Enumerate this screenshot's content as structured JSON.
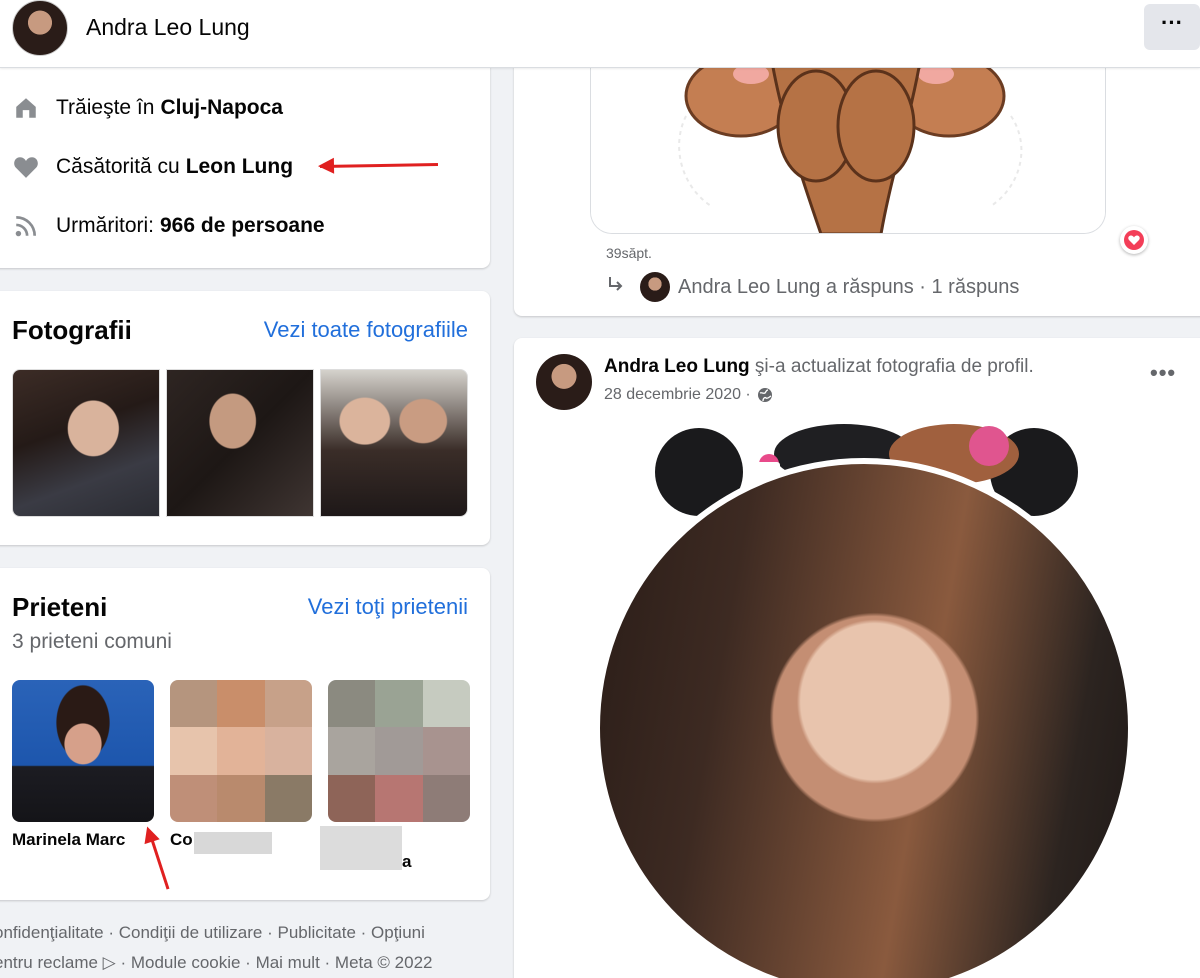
{
  "header": {
    "name": "Andra Leo Lung",
    "more_label": "···"
  },
  "intro": {
    "lives_prefix": "Trăieşte în",
    "lives_city": "Cluj-Napoca",
    "married_prefix": "Căsătorită cu",
    "married_to": "Leon Lung",
    "followers_prefix": "Urmăritori:",
    "followers_count": "966 de persoane"
  },
  "photos": {
    "title": "Fotografii",
    "link": "Vezi toate fotografiile"
  },
  "friends": {
    "title": "Prieteni",
    "link": "Vezi toţi prietenii",
    "mutual": "3 prieteni comuni",
    "items": [
      {
        "name": "Marinela Marc"
      },
      {
        "name": "Co"
      },
      {
        "name": "a"
      }
    ]
  },
  "footer": {
    "line1": "onfidenţialitate · Condiţii de utilizare · Publicitate · Opţiuni",
    "line2": "entru reclame ▷ · Module cookie · Mai mult · Meta © 2022"
  },
  "post1": {
    "time": "39săpt.",
    "reply_text": "Andra Leo Lung a răspuns · 1 răspuns"
  },
  "post2": {
    "author": "Andra Leo Lung",
    "action": " şi-a actualizat fotografia de profil.",
    "date": "28 decembrie 2020 ·",
    "dots": "•••"
  },
  "colors": {
    "link": "#216fdb",
    "annotation_arrow": "#e02020",
    "heart": "#f33e58"
  },
  "icons": [
    "home-icon",
    "heart-icon",
    "rss-icon",
    "globe-icon",
    "reply-arrow-icon",
    "more-dots-icon"
  ]
}
